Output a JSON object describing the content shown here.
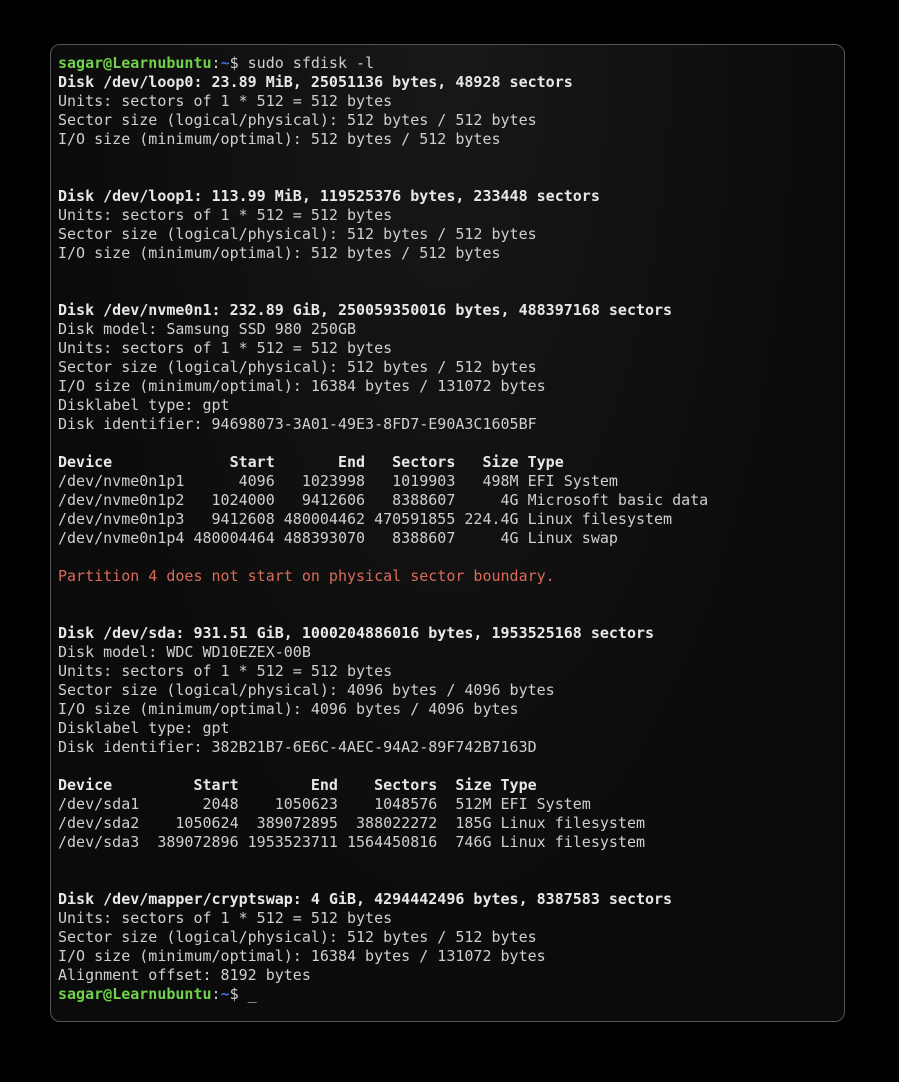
{
  "prompt": {
    "user": "sagar",
    "at": "@",
    "host": "Learnubuntu",
    "colon": ":",
    "path": "~",
    "dollar": "$",
    "command": " sudo sfdisk -l"
  },
  "loop0": {
    "header": "Disk /dev/loop0: 23.89 MiB, 25051136 bytes, 48928 sectors",
    "units": "Units: sectors of 1 * 512 = 512 bytes",
    "sector": "Sector size (logical/physical): 512 bytes / 512 bytes",
    "io": "I/O size (minimum/optimal): 512 bytes / 512 bytes"
  },
  "loop1": {
    "header": "Disk /dev/loop1: 113.99 MiB, 119525376 bytes, 233448 sectors",
    "units": "Units: sectors of 1 * 512 = 512 bytes",
    "sector": "Sector size (logical/physical): 512 bytes / 512 bytes",
    "io": "I/O size (minimum/optimal): 512 bytes / 512 bytes"
  },
  "nvme": {
    "header": "Disk /dev/nvme0n1: 232.89 GiB, 250059350016 bytes, 488397168 sectors",
    "model": "Disk model: Samsung SSD 980 250GB",
    "units": "Units: sectors of 1 * 512 = 512 bytes",
    "sector": "Sector size (logical/physical): 512 bytes / 512 bytes",
    "io": "I/O size (minimum/optimal): 16384 bytes / 131072 bytes",
    "label": "Disklabel type: gpt",
    "ident": "Disk identifier: 94698073-3A01-49E3-8FD7-E90A3C1605BF",
    "tblhdr": "Device             Start       End   Sectors   Size Type",
    "p1": "/dev/nvme0n1p1      4096   1023998   1019903   498M EFI System",
    "p2": "/dev/nvme0n1p2   1024000   9412606   8388607     4G Microsoft basic data",
    "p3": "/dev/nvme0n1p3   9412608 480004462 470591855 224.4G Linux filesystem",
    "p4": "/dev/nvme0n1p4 480004464 488393070   8388607     4G Linux swap"
  },
  "warning": "Partition 4 does not start on physical sector boundary.",
  "sda": {
    "header": "Disk /dev/sda: 931.51 GiB, 1000204886016 bytes, 1953525168 sectors",
    "model": "Disk model: WDC WD10EZEX-00B",
    "units": "Units: sectors of 1 * 512 = 512 bytes",
    "sector": "Sector size (logical/physical): 4096 bytes / 4096 bytes",
    "io": "I/O size (minimum/optimal): 4096 bytes / 4096 bytes",
    "label": "Disklabel type: gpt",
    "ident": "Disk identifier: 382B21B7-6E6C-4AEC-94A2-89F742B7163D",
    "tblhdr": "Device         Start        End    Sectors  Size Type",
    "p1": "/dev/sda1       2048    1050623    1048576  512M EFI System",
    "p2": "/dev/sda2    1050624  389072895  388022272  185G Linux filesystem",
    "p3": "/dev/sda3  389072896 1953523711 1564450816  746G Linux filesystem"
  },
  "crypt": {
    "header": "Disk /dev/mapper/cryptswap: 4 GiB, 4294442496 bytes, 8387583 sectors",
    "units": "Units: sectors of 1 * 512 = 512 bytes",
    "sector": "Sector size (logical/physical): 512 bytes / 512 bytes",
    "io": "I/O size (minimum/optimal): 16384 bytes / 131072 bytes",
    "align": "Alignment offset: 8192 bytes"
  },
  "prompt2": {
    "cursor": "_"
  }
}
